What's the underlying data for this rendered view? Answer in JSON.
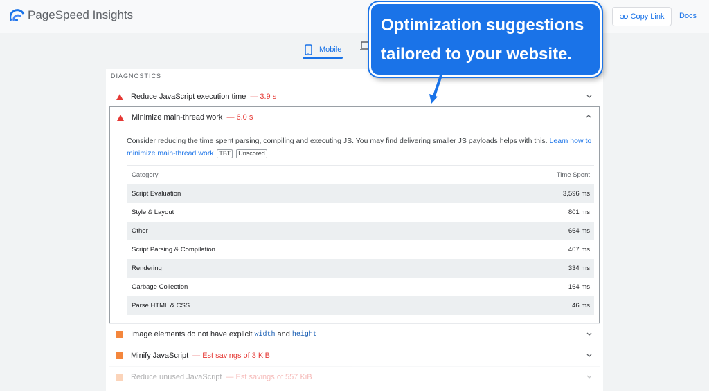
{
  "app": {
    "title": "PageSpeed Insights"
  },
  "header": {
    "copy_link": "Copy Link",
    "docs": "Docs"
  },
  "tabs": {
    "mobile": "Mobile"
  },
  "diagnostics": {
    "heading": "DIAGNOSTICS",
    "audits": [
      {
        "title": "Reduce JavaScript execution time",
        "value": "— 3.9 s",
        "severity": "fail"
      },
      {
        "title": "Minimize main-thread work",
        "value": "— 6.0 s",
        "severity": "fail"
      },
      {
        "title_pre": "Image elements do not have explicit",
        "code1": "width",
        "mid": "and",
        "code2": "height",
        "severity": "average"
      },
      {
        "title": "Minify JavaScript",
        "value": "— Est savings of 3 KiB",
        "severity": "average"
      },
      {
        "title": "Reduce unused JavaScript",
        "value": "— Est savings of 557 KiB",
        "severity": "average"
      }
    ],
    "expanded": {
      "description": "Consider reducing the time spent parsing, compiling and executing JS. You may find delivering smaller JS payloads helps with this.",
      "link_text": "Learn how to minimize main-thread work",
      "badges": [
        "TBT",
        "Unscored"
      ],
      "table": {
        "headers": [
          "Category",
          "Time Spent"
        ],
        "rows": [
          [
            "Script Evaluation",
            "3,596 ms"
          ],
          [
            "Style & Layout",
            "801 ms"
          ],
          [
            "Other",
            "664 ms"
          ],
          [
            "Script Parsing & Compilation",
            "407 ms"
          ],
          [
            "Rendering",
            "334 ms"
          ],
          [
            "Garbage Collection",
            "164 ms"
          ],
          [
            "Parse HTML & CSS",
            "46 ms"
          ]
        ]
      }
    }
  },
  "callout": {
    "line1": "Optimization suggestions",
    "line2": "tailored to your website."
  },
  "colors": {
    "accent": "#1a73e8",
    "fail": "#e53935",
    "average": "#f4863c"
  },
  "icons": {
    "logo": "pagespeed-logo-icon",
    "link": "link-icon",
    "mobile": "mobile-phone-icon",
    "desktop": "desktop-icon",
    "chevron": "chevron-icon"
  }
}
